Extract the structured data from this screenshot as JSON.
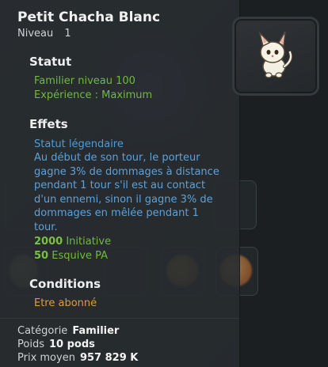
{
  "item": {
    "name": "Petit Chacha Blanc",
    "level_label": "Niveau",
    "level_value": "1"
  },
  "statut": {
    "heading": "Statut",
    "lines": [
      "Familier niveau 100",
      "Expérience : Maximum"
    ]
  },
  "effets": {
    "heading": "Effets",
    "legendary": "Statut légendaire",
    "description": "Au début de son tour, le porteur gagne 3% de dommages à distance pendant 1 tour s'il est au contact d'un ennemi, sinon il gagne 3% de dommages en mêlée pendant 1 tour.",
    "stats": [
      {
        "value": "2000",
        "label": "Initiative"
      },
      {
        "value": "50",
        "label": "Esquive PA"
      }
    ]
  },
  "conditions": {
    "heading": "Conditions",
    "lines": [
      "Etre abonné"
    ]
  },
  "footer": {
    "categorie_label": "Catégorie",
    "categorie_value": "Familier",
    "poids_label": "Poids",
    "poids_value": "10 pods",
    "prix_label": "Prix moyen",
    "prix_value": "957 829 K"
  },
  "colors": {
    "green": "#6fba3d",
    "blue": "#4f9bd5",
    "orange": "#e09a3e"
  }
}
